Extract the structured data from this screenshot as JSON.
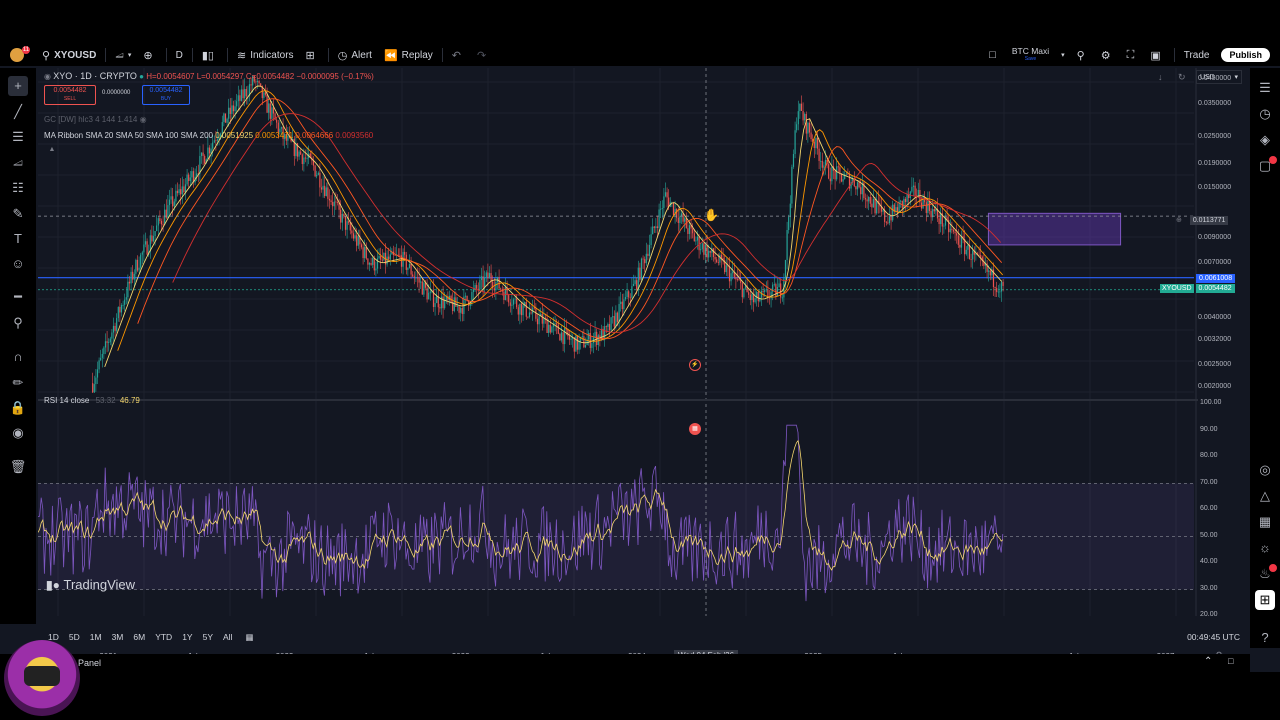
{
  "toolbar": {
    "avatar_badge": "11",
    "symbol": "XYOUSD",
    "interval": "D",
    "indicators": "Indicators",
    "alert": "Alert",
    "replay": "Replay",
    "layout_name": "BTC Maxi",
    "layout_sub": "Save",
    "trade": "Trade",
    "publish": "Publish"
  },
  "legend": {
    "title": "XYO · 1D · CRYPTO",
    "ohlc_h": "H=0.0054607",
    "ohlc_l": "L=0.0054297",
    "ohlc_c": "C=0.0054482",
    "change": "−0.0000095 (−0.17%)",
    "sell_price": "0.0054482",
    "sell_label": "SELL",
    "spread": "0.0000000",
    "buy_price": "0.0054482",
    "buy_label": "BUY",
    "gc_line": "GC [DW] hlc3 4 144 1.414",
    "ma_label": "MA Ribbon SMA 20 SMA 50 SMA 100 SMA 200",
    "ma1": "0.0051925",
    "ma2": "0.0053471",
    "ma3": "0.0064666",
    "ma4": "0.0093560"
  },
  "currency": "USD",
  "price_axis": [
    "0.0450000",
    "0.0350000",
    "0.0250000",
    "0.0190000",
    "0.0150000",
    "0.0090000",
    "0.0070000",
    "0.0040000",
    "0.0032000",
    "0.0025000",
    "0.0020000"
  ],
  "crosshair_price": "0.0113771",
  "line_price": "0.0061008",
  "symbol_price_label": "XYOUSD",
  "symbol_price": "0.0054482",
  "rsi": {
    "label": "RSI 14 close",
    "value1": "53.32",
    "value2": "46.79",
    "axis": [
      "100.00",
      "90.00",
      "80.00",
      "70.00",
      "60.00",
      "50.00",
      "40.00",
      "30.00",
      "20.00"
    ]
  },
  "time_axis": [
    "2021",
    "Jul",
    "2022",
    "Jul",
    "2023",
    "Jul",
    "2024",
    "Jul",
    "2025",
    "Jul",
    "Jul",
    "2027"
  ],
  "crosshair_date": "Wed 04 Feb '26",
  "watermark": "TradingView",
  "ranges": [
    "1D",
    "5D",
    "1M",
    "3M",
    "6M",
    "YTD",
    "1Y",
    "5Y",
    "All"
  ],
  "clock": "00:49:45 UTC",
  "panel_label": "Panel",
  "colors": {
    "bg": "#131722",
    "up": "#26a69a",
    "down": "#ef5350",
    "hline": "#2962ff",
    "rsi": "#7e57c2",
    "rect": "#673ab7",
    "price_green": "#22ab94"
  },
  "chart_data": {
    "type": "line",
    "title": "XYO · 1D · CRYPTO",
    "x_range": [
      "2020-11",
      "2027-03"
    ],
    "y_scale": "log",
    "ylim": [
      0.0019,
      0.046
    ],
    "series": [
      {
        "x": [
          "2020-12",
          "2021-03",
          "2021-05",
          "2021-07",
          "2021-09",
          "2021-11",
          "2022-01",
          "2022-03",
          "2022-05",
          "2022-07",
          "2022-09",
          "2022-11",
          "2023-01",
          "2023-03",
          "2023-05",
          "2023-07",
          "2023-09",
          "2023-11",
          "2024-01",
          "2024-03",
          "2024-05",
          "2024-07",
          "2024-09",
          "2024-11",
          "2024-12",
          "2025-02",
          "2025-04",
          "2025-06",
          "2025-08",
          "2025-10",
          "2025-12",
          "2026-02"
        ],
        "values": [
          0.0021,
          0.007,
          0.012,
          0.018,
          0.03,
          0.045,
          0.025,
          0.019,
          0.011,
          0.007,
          0.0075,
          0.005,
          0.0045,
          0.0062,
          0.0046,
          0.0038,
          0.0031,
          0.0035,
          0.0058,
          0.014,
          0.009,
          0.0068,
          0.0048,
          0.0055,
          0.035,
          0.018,
          0.016,
          0.011,
          0.0145,
          0.0105,
          0.0075,
          0.0054
        ]
      }
    ],
    "hline": 0.0061008,
    "zone": {
      "x0": "2026-01",
      "x1": "2026-10",
      "y0": 0.0085,
      "y1": 0.0117
    },
    "rsi_range": [
      20,
      100
    ],
    "rsi_bands": [
      30,
      50,
      70
    ],
    "rsi_last": 46.79,
    "grid": true
  }
}
